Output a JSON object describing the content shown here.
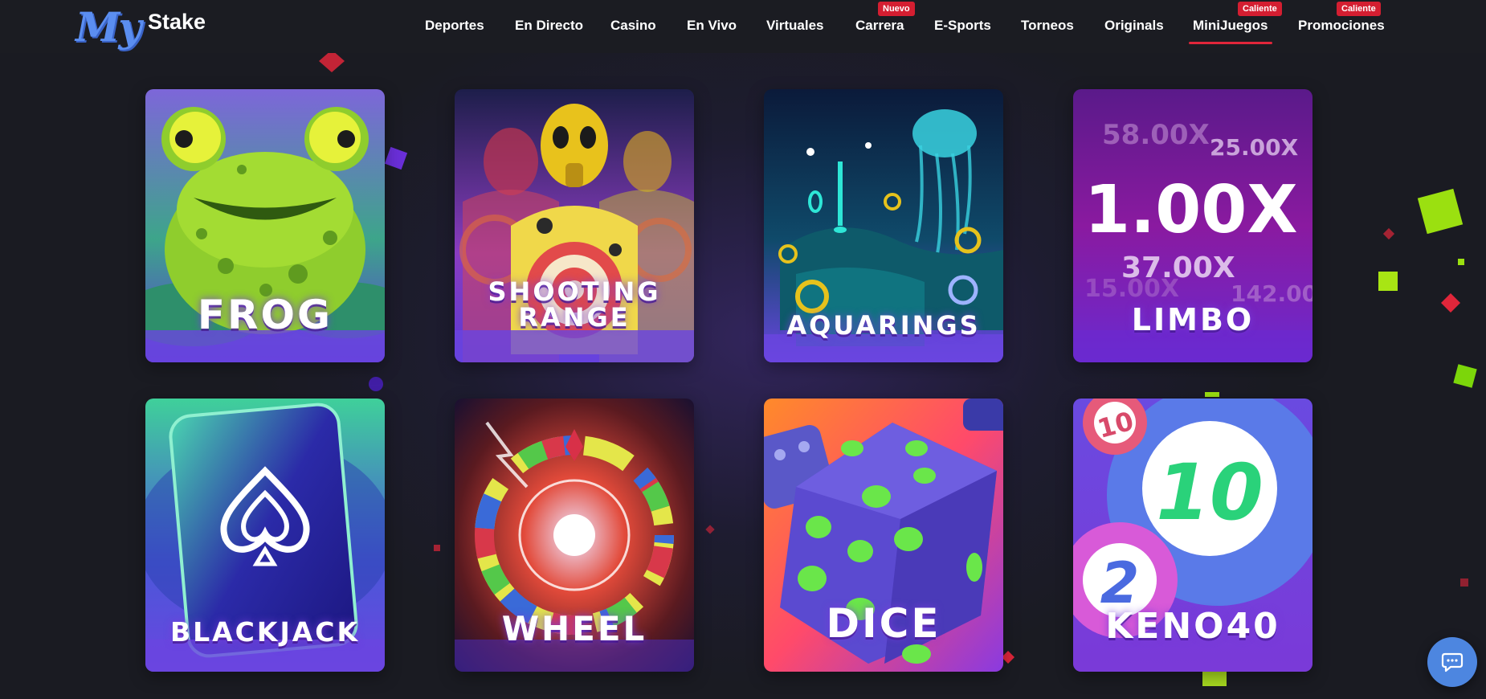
{
  "logo": {
    "my": "My",
    "stake": "Stake"
  },
  "nav": {
    "items": [
      {
        "label": "Deportes"
      },
      {
        "label": "En Directo"
      },
      {
        "label": "Casino"
      },
      {
        "label": "En Vivo"
      },
      {
        "label": "Virtuales"
      },
      {
        "label": "Carrera",
        "badge": "Nuevo"
      },
      {
        "label": "E-Sports"
      },
      {
        "label": "Torneos"
      },
      {
        "label": "Originals"
      },
      {
        "label": "MiniJuegos",
        "badge": "Caliente",
        "active": true
      },
      {
        "label": "Promociones",
        "badge": "Caliente"
      }
    ]
  },
  "games": [
    {
      "title_lines": [
        "FROG"
      ]
    },
    {
      "title_lines": [
        "SHOOTING",
        "RANGE"
      ]
    },
    {
      "title_lines": [
        "AQUARINGS"
      ]
    },
    {
      "title_lines": [
        "LIMBO"
      ],
      "multipliers": [
        "58.00X",
        "25.00X",
        "1.00X",
        "37.00X",
        "15.00X",
        "142.00"
      ]
    },
    {
      "title_lines": [
        "BLACKJACK"
      ]
    },
    {
      "title_lines": [
        "WHEEL"
      ]
    },
    {
      "title_lines": [
        "DICE"
      ]
    },
    {
      "title_lines": [
        "KENO40"
      ],
      "balls": [
        "10",
        "10",
        "2"
      ]
    }
  ],
  "chat": {
    "icon": "chat-bubble-icon"
  },
  "colors": {
    "background": "#1a1b22",
    "accent": "#e0263a",
    "badge": "#d41e31",
    "chat": "#4d86e0"
  }
}
